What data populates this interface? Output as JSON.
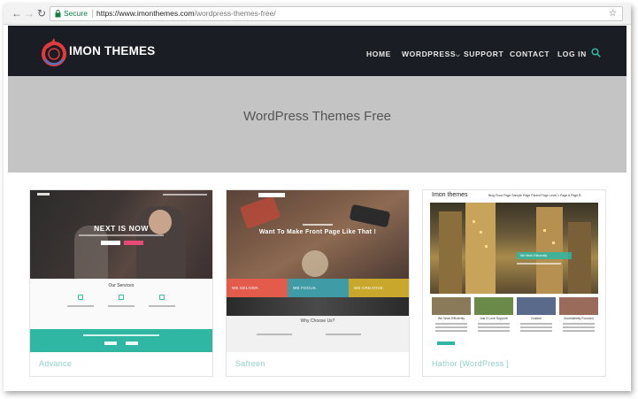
{
  "browser": {
    "back_icon": "arrow-left-icon",
    "forward_icon": "arrow-right-icon",
    "reload_icon": "reload-icon",
    "secure_label": "Secure",
    "url_host": "https://www.imonthemes.com",
    "url_path": "/wordpress-themes-free/",
    "bookmark_icon": "star-icon"
  },
  "site": {
    "brand": "IMON THEMES",
    "brand_color": "#e23b3b",
    "nav": {
      "home": "HOME",
      "wordpress": "WORDPRESS",
      "support": "SUPPORT",
      "contact": "CONTACT",
      "login": "LOG IN"
    },
    "accent_color": "#2fb7a3"
  },
  "hero": {
    "title": "WordPress Themes Free"
  },
  "themes": [
    {
      "label": "Advance",
      "preview": {
        "headline": "NEXT IS NOW",
        "section_title": "Our Services"
      }
    },
    {
      "label": "Safreen",
      "preview": {
        "headline": "Want To Make Front Page Like That !",
        "panel_1": "WE DELIVER.",
        "panel_2": "WE FOCUS.",
        "panel_3": "WE CREATIVE.",
        "section_title": "Why Choose Us?"
      }
    },
    {
      "label": "Hathor [WordPress ]",
      "preview": {
        "brand": "Imon themes",
        "nav": "Blog   Front Page   Sample Page   Parent Page   Level 1   Page A   Page B",
        "overlay": "We Work Efficiently",
        "tiles": [
          "We Work Efficiently",
          "Just 5 Love Support!",
          "Custom",
          "Accessibility Focused"
        ]
      }
    }
  ]
}
